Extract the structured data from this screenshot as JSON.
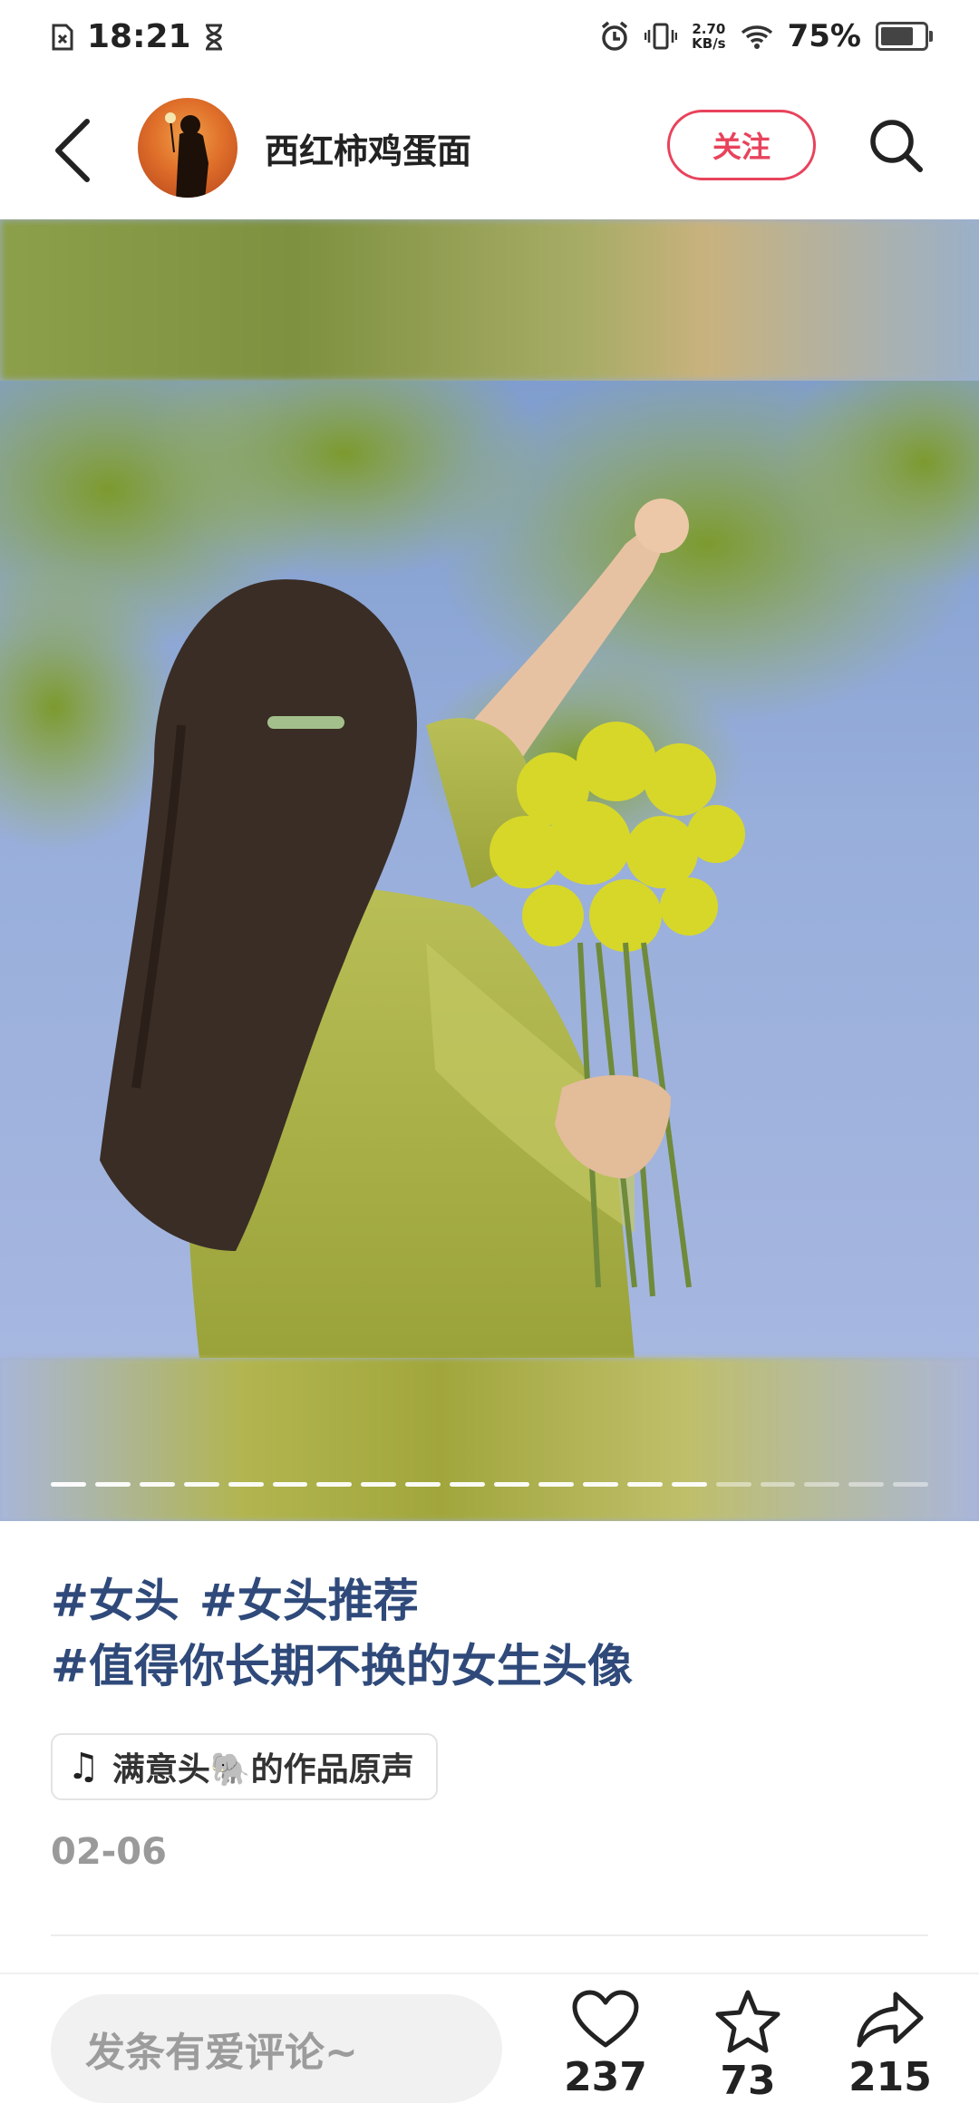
{
  "status_bar": {
    "time": "18:21",
    "network_speed_value": "2.70",
    "network_speed_unit": "KB/s",
    "battery_percent": "75%",
    "battery_level": 0.75
  },
  "header": {
    "author_name": "西红柿鸡蛋面",
    "follow_label": "关注"
  },
  "media": {
    "page_count": 20,
    "current_page": 15
  },
  "post": {
    "tags": [
      "#女头",
      "#女头推荐",
      "#值得你长期不换的女生头像"
    ],
    "music_label": "满意头🐘的作品原声",
    "date": "02-06"
  },
  "bottom_bar": {
    "comment_placeholder": "发条有爱评论~",
    "likes": "237",
    "favorites": "73",
    "shares": "215"
  },
  "colors": {
    "accent": "#e8435c",
    "tag_color": "#2f4a7a"
  }
}
